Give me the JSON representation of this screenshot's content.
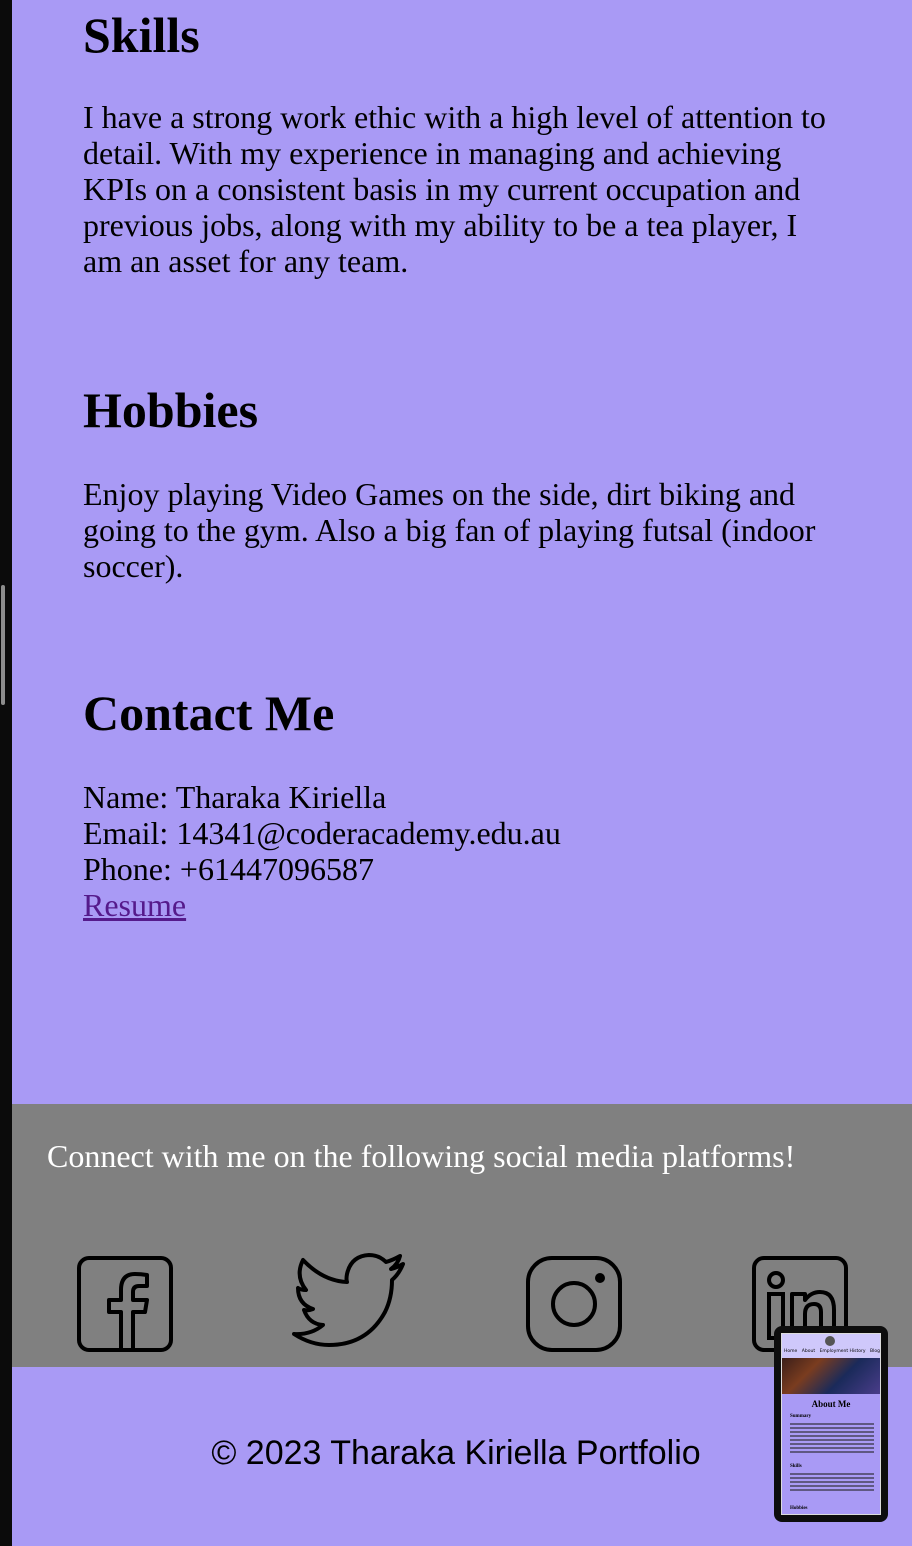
{
  "skills": {
    "heading": "Skills",
    "text": "I have a strong work ethic with a high level of attention to detail. With my experience in managing and achieving KPIs on a consistent basis in my current occupation and previous jobs, along with my ability to be a tea player, I am an asset for any team."
  },
  "hobbies": {
    "heading": "Hobbies",
    "text": "Enjoy playing Video Games on the side, dirt biking and going to the gym. Also a big fan of playing futsal (indoor soccer)."
  },
  "contact": {
    "heading": "Contact Me",
    "name": "Name: Tharaka Kiriella",
    "email": "Email: 14341@coderacademy.edu.au",
    "phone": "Phone: +61447096587",
    "resume_label": "Resume"
  },
  "footer": {
    "social_text": "Connect with me on the following social media platforms!",
    "icons": [
      "facebook-icon",
      "twitter-icon",
      "instagram-icon",
      "linkedin-icon"
    ],
    "copyright": "© 2023 Tharaka Kiriella Portfolio"
  },
  "preview": {
    "nav": [
      "Home",
      "About",
      "Employment History",
      "Blog"
    ],
    "title": "About Me",
    "summary_heading": "Summary",
    "skills_heading": "Skills",
    "hobbies_heading": "Hobbies"
  },
  "colors": {
    "background": "#a99af5",
    "footer_band": "#808080",
    "link": "#551a8b"
  }
}
